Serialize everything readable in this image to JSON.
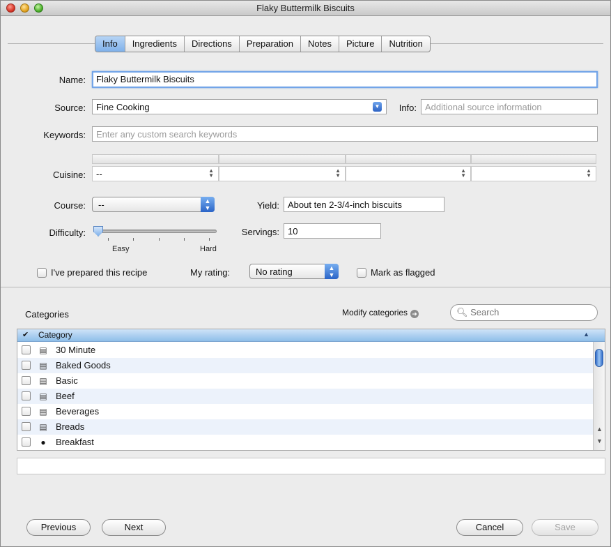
{
  "window": {
    "title": "Flaky Buttermilk Biscuits"
  },
  "tabs": [
    {
      "label": "Info"
    },
    {
      "label": "Ingredients"
    },
    {
      "label": "Directions"
    },
    {
      "label": "Preparation"
    },
    {
      "label": "Notes"
    },
    {
      "label": "Picture"
    },
    {
      "label": "Nutrition"
    }
  ],
  "form": {
    "name_label": "Name:",
    "name_value": "Flaky Buttermilk Biscuits",
    "source_label": "Source:",
    "source_value": "Fine Cooking",
    "info_label": "Info:",
    "info_placeholder": "Additional source information",
    "keywords_label": "Keywords:",
    "keywords_placeholder": "Enter any custom search keywords",
    "cuisine_label": "Cuisine:",
    "cuisine_values": [
      "--",
      "",
      "",
      ""
    ],
    "course_label": "Course:",
    "course_value": "--",
    "yield_label": "Yield:",
    "yield_value": "About ten 2-3/4-inch biscuits",
    "difficulty_label": "Difficulty:",
    "difficulty_level": 0,
    "difficulty_easy": "Easy",
    "difficulty_hard": "Hard",
    "servings_label": "Servings:",
    "servings_value": "10",
    "prepared_label": "I've prepared this recipe",
    "rating_label": "My rating:",
    "rating_value": "No rating",
    "flagged_label": "Mark as flagged"
  },
  "categories": {
    "title": "Categories",
    "modify_label": "Modify categories",
    "search_placeholder": "Search",
    "header_check": "✔",
    "header_label": "Category",
    "rows": [
      {
        "name": "30 Minute",
        "icon": "document-icon"
      },
      {
        "name": "Baked Goods",
        "icon": "document-icon"
      },
      {
        "name": "Basic",
        "icon": "document-icon"
      },
      {
        "name": "Beef",
        "icon": "document-icon"
      },
      {
        "name": "Beverages",
        "icon": "document-icon"
      },
      {
        "name": "Breads",
        "icon": "document-icon"
      },
      {
        "name": "Breakfast",
        "icon": "person-icon"
      }
    ]
  },
  "buttons": {
    "previous": "Previous",
    "next": "Next",
    "cancel": "Cancel",
    "save": "Save"
  }
}
